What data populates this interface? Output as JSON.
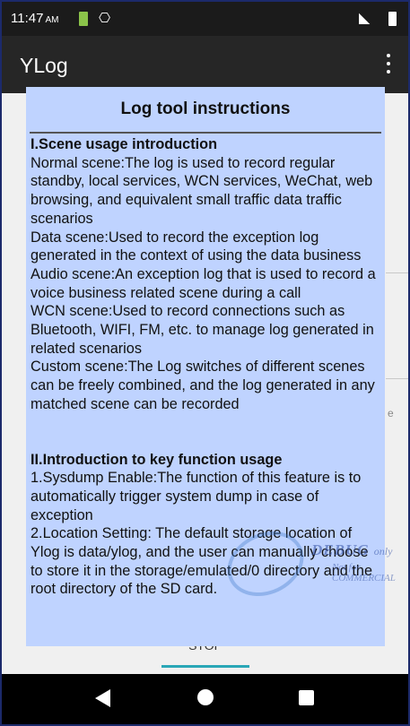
{
  "status_bar": {
    "time": "11:47",
    "ampm": "AM"
  },
  "app_bar": {
    "title": "YLog"
  },
  "background": {
    "stop_button": "STOP"
  },
  "dialog": {
    "title": "Log tool instructions",
    "section1_heading": "I.Scene usage introduction",
    "section1_items": [
      "Normal scene:The log is used to record regular standby, local services, WCN services, WeChat, web browsing, and equivalent small traffic data traffic scenarios",
      "Data scene:Used to record the exception log generated in the context of using the data business",
      "Audio scene:An exception log that is used to record a voice business related scene during a call",
      "WCN scene:Used to record connections such as Bluetooth, WIFI, FM, etc. to manage log generated in related scenarios",
      "Custom scene:The Log switches of different scenes can be freely combined, and the log generated in any matched scene can be recorded"
    ],
    "section2_heading": "II.Introduction to key function usage",
    "section2_items": [
      "1.Sysdump Enable:The function of this feature is to automatically trigger system dump in case of exception",
      "2.Location Setting: The default storage location of Ylog is data/ylog, and the user can manually choose to store it in the storage/emulated/0 directory and the root directory of the SD card."
    ]
  },
  "watermark": {
    "line1": "DEBUG",
    "line1_suffix": "only",
    "line2": "Not for COMMERCIAL"
  },
  "icons": [
    "battery-saver-icon",
    "usb-debug-icon",
    "notification-icon",
    "battery-icon",
    "overflow-menu-icon",
    "back-icon",
    "home-icon",
    "recents-icon"
  ]
}
